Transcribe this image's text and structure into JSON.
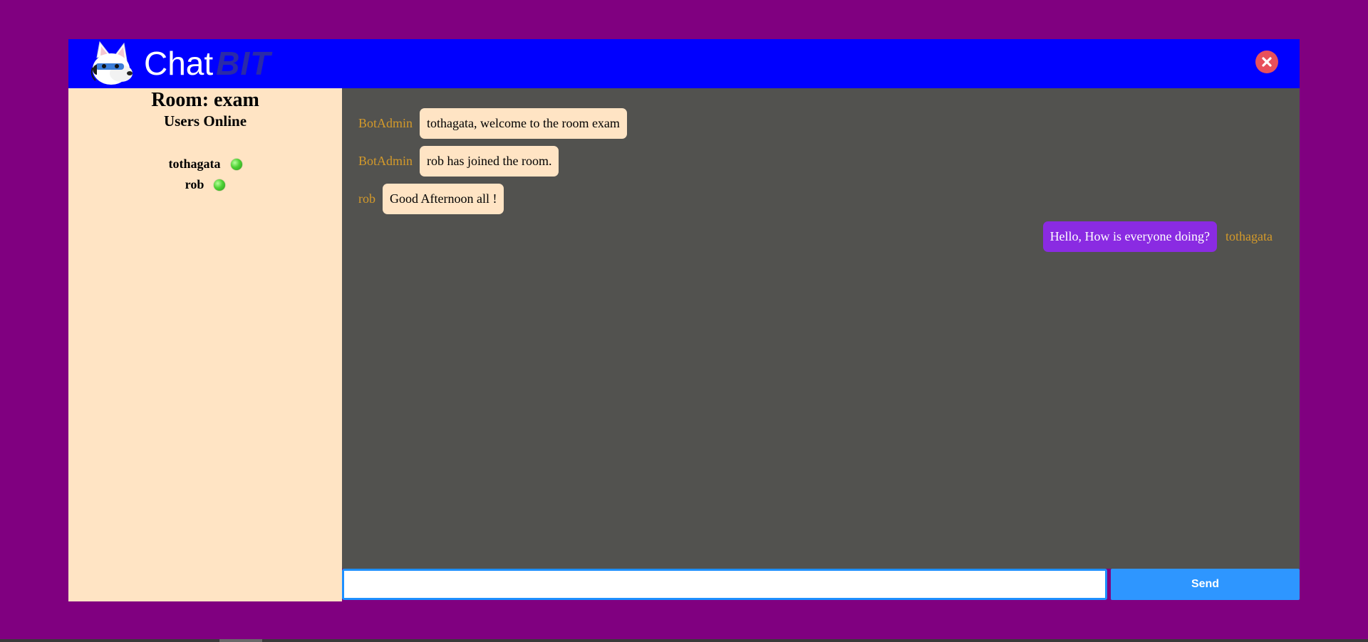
{
  "app": {
    "logo_text_main": "Chat",
    "logo_text_accent": "BIT",
    "logo_icon": "husky-mascot-icon",
    "close_icon": "close-icon"
  },
  "sidebar": {
    "room_title": "Room: exam",
    "users_heading": "Users Online",
    "users": [
      {
        "name": "tothagata",
        "status": "online"
      },
      {
        "name": "rob",
        "status": "online"
      }
    ]
  },
  "messages": [
    {
      "sender": "BotAdmin",
      "text": "tothagata, welcome to the room exam",
      "direction": "incoming"
    },
    {
      "sender": "BotAdmin",
      "text": "rob has joined the room.",
      "direction": "incoming"
    },
    {
      "sender": "rob",
      "text": "Good Afternoon all !",
      "direction": "incoming"
    },
    {
      "sender": "tothagata",
      "text": "Hello, How is everyone doing?",
      "direction": "outgoing"
    }
  ],
  "composer": {
    "input_value": "",
    "input_placeholder": "",
    "send_label": "Send"
  },
  "colors": {
    "page_background": "#800080",
    "header_background": "#0000ff",
    "sidebar_background": "#ffe4c4",
    "chat_background": "#52524f",
    "incoming_bubble": "#ffe4c4",
    "outgoing_bubble": "#8a2be2",
    "sender_name": "#d49a2a",
    "send_button": "#2e96ff",
    "close_button": "#e8505b",
    "online_indicator": "#4ed134"
  }
}
